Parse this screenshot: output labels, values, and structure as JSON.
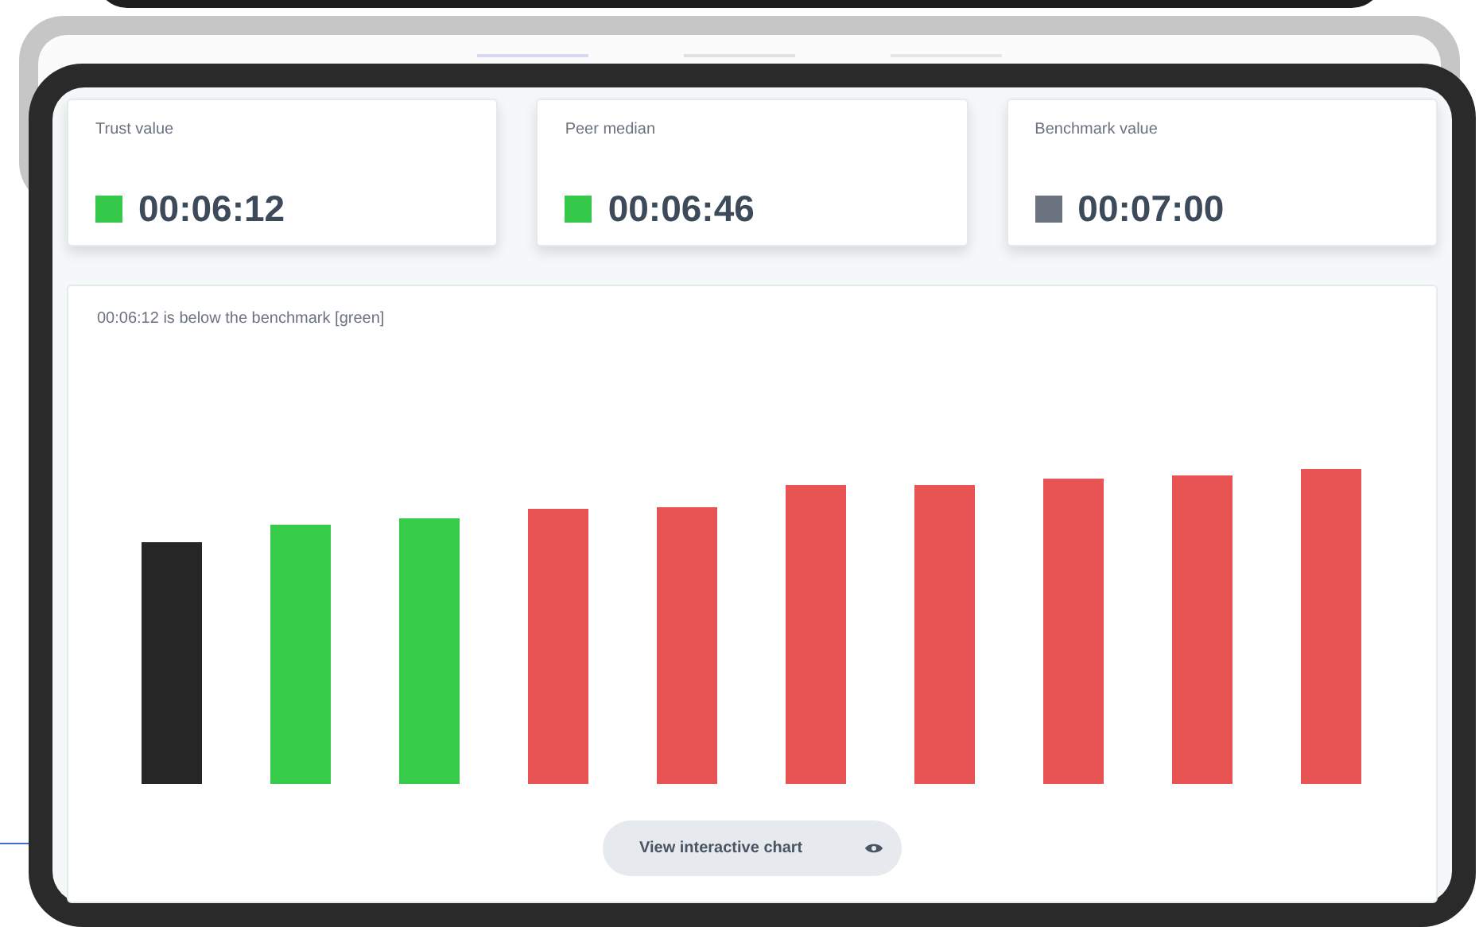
{
  "cards": [
    {
      "label": "Trust value",
      "value": "00:06:12",
      "color": "#34c94a"
    },
    {
      "label": "Peer median",
      "value": "00:06:46",
      "color": "#34c94a"
    },
    {
      "label": "Benchmark value",
      "value": "00:07:00",
      "color": "#6b7280"
    }
  ],
  "chart": {
    "caption": "00:06:12 is below the benchmark [green]",
    "bars": [
      {
        "color": "#262626"
      },
      {
        "color": "#36cc4a"
      },
      {
        "color": "#36cc4a"
      },
      {
        "color": "#e85454"
      },
      {
        "color": "#e85454"
      },
      {
        "color": "#e85454"
      },
      {
        "color": "#e85454"
      },
      {
        "color": "#e85454"
      },
      {
        "color": "#e85454"
      },
      {
        "color": "#e85454"
      }
    ],
    "button": "View interactive chart"
  }
}
